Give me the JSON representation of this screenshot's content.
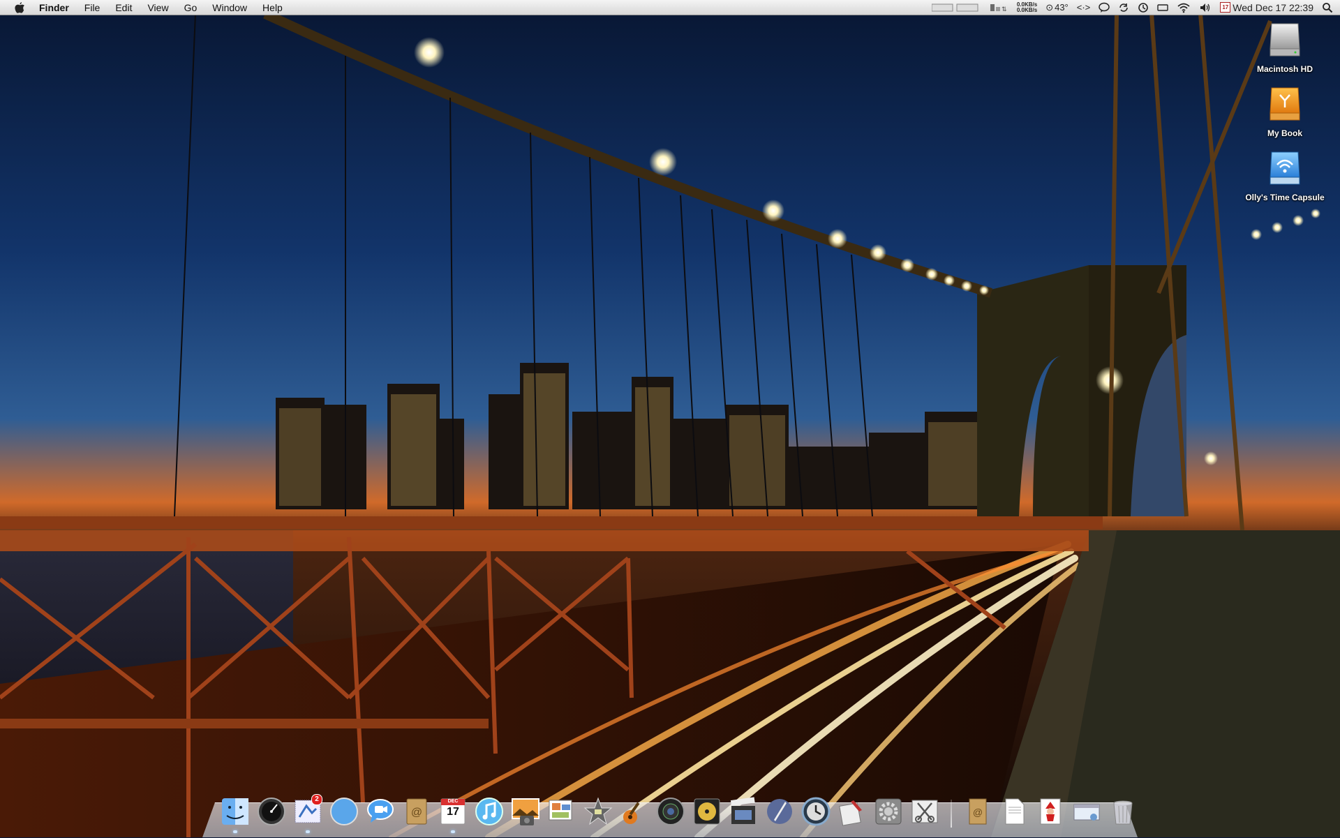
{
  "menubar": {
    "app_name": "Finder",
    "menus": [
      "File",
      "Edit",
      "View",
      "Go",
      "Window",
      "Help"
    ],
    "net_up": "0.0KB/s",
    "net_down": "0.0KB/s",
    "temperature": "43°",
    "clock": "Wed Dec 17  22:39",
    "calendar_icon_day": "17"
  },
  "desktop": {
    "icons": [
      {
        "label": "Macintosh HD",
        "icon": "hard-drive-icon"
      },
      {
        "label": "My Book",
        "icon": "external-drive-icon"
      },
      {
        "label": "Olly's Time Capsule",
        "icon": "time-capsule-icon"
      }
    ]
  },
  "dock": {
    "mail_badge": "2",
    "ical_day": "17",
    "ical_month": "DEC",
    "apps": [
      "finder",
      "dashboard",
      "mail",
      "safari",
      "ichat",
      "address-book",
      "ical",
      "itunes",
      "iphoto",
      "preview",
      "imovie",
      "garageband",
      "aperture",
      "dvd",
      "iphoto-2",
      "photo-booth",
      "time-machine",
      "textedit",
      "system-preferences",
      "grab"
    ],
    "docs": [
      "address-doc",
      "rtf-doc",
      "santa-doc",
      "window-doc",
      "trash"
    ],
    "colors": {
      "accent_blue": "#2a7fd8",
      "badge_red": "#e0201e"
    }
  }
}
